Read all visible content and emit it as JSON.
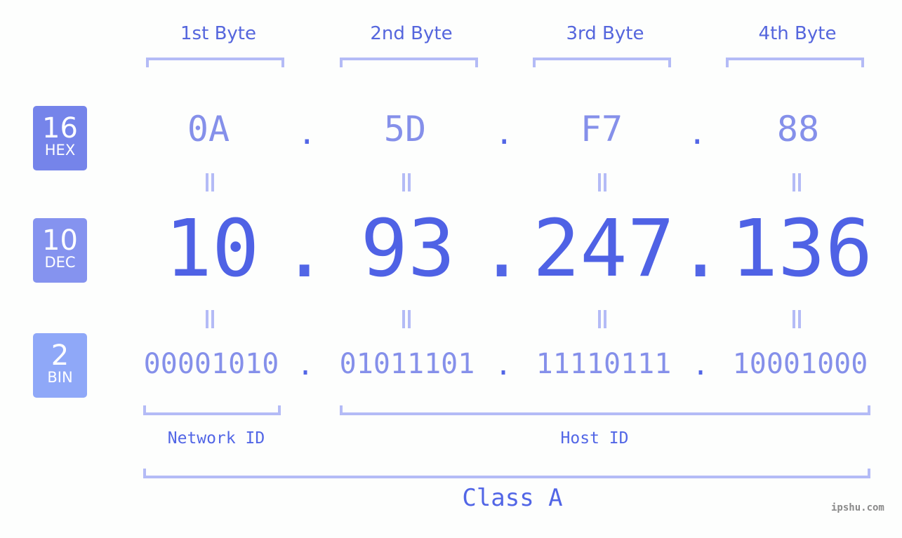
{
  "badges": [
    {
      "num": "16",
      "label": "HEX",
      "color": "#7584ea"
    },
    {
      "num": "10",
      "label": "DEC",
      "color": "#8593ef"
    },
    {
      "num": "2",
      "label": "BIN",
      "color": "#8fa8f8"
    }
  ],
  "byte_headers": [
    "1st Byte",
    "2nd Byte",
    "3rd Byte",
    "4th Byte"
  ],
  "hex": [
    "0A",
    "5D",
    "F7",
    "88"
  ],
  "dec": [
    "10",
    "93",
    "247",
    "136"
  ],
  "bin": [
    "00001010",
    "01011101",
    "11110111",
    "10001000"
  ],
  "separator": ".",
  "network_id_label": "Network ID",
  "host_id_label": "Host ID",
  "class_label": "Class A",
  "watermark": "ipshu.com"
}
